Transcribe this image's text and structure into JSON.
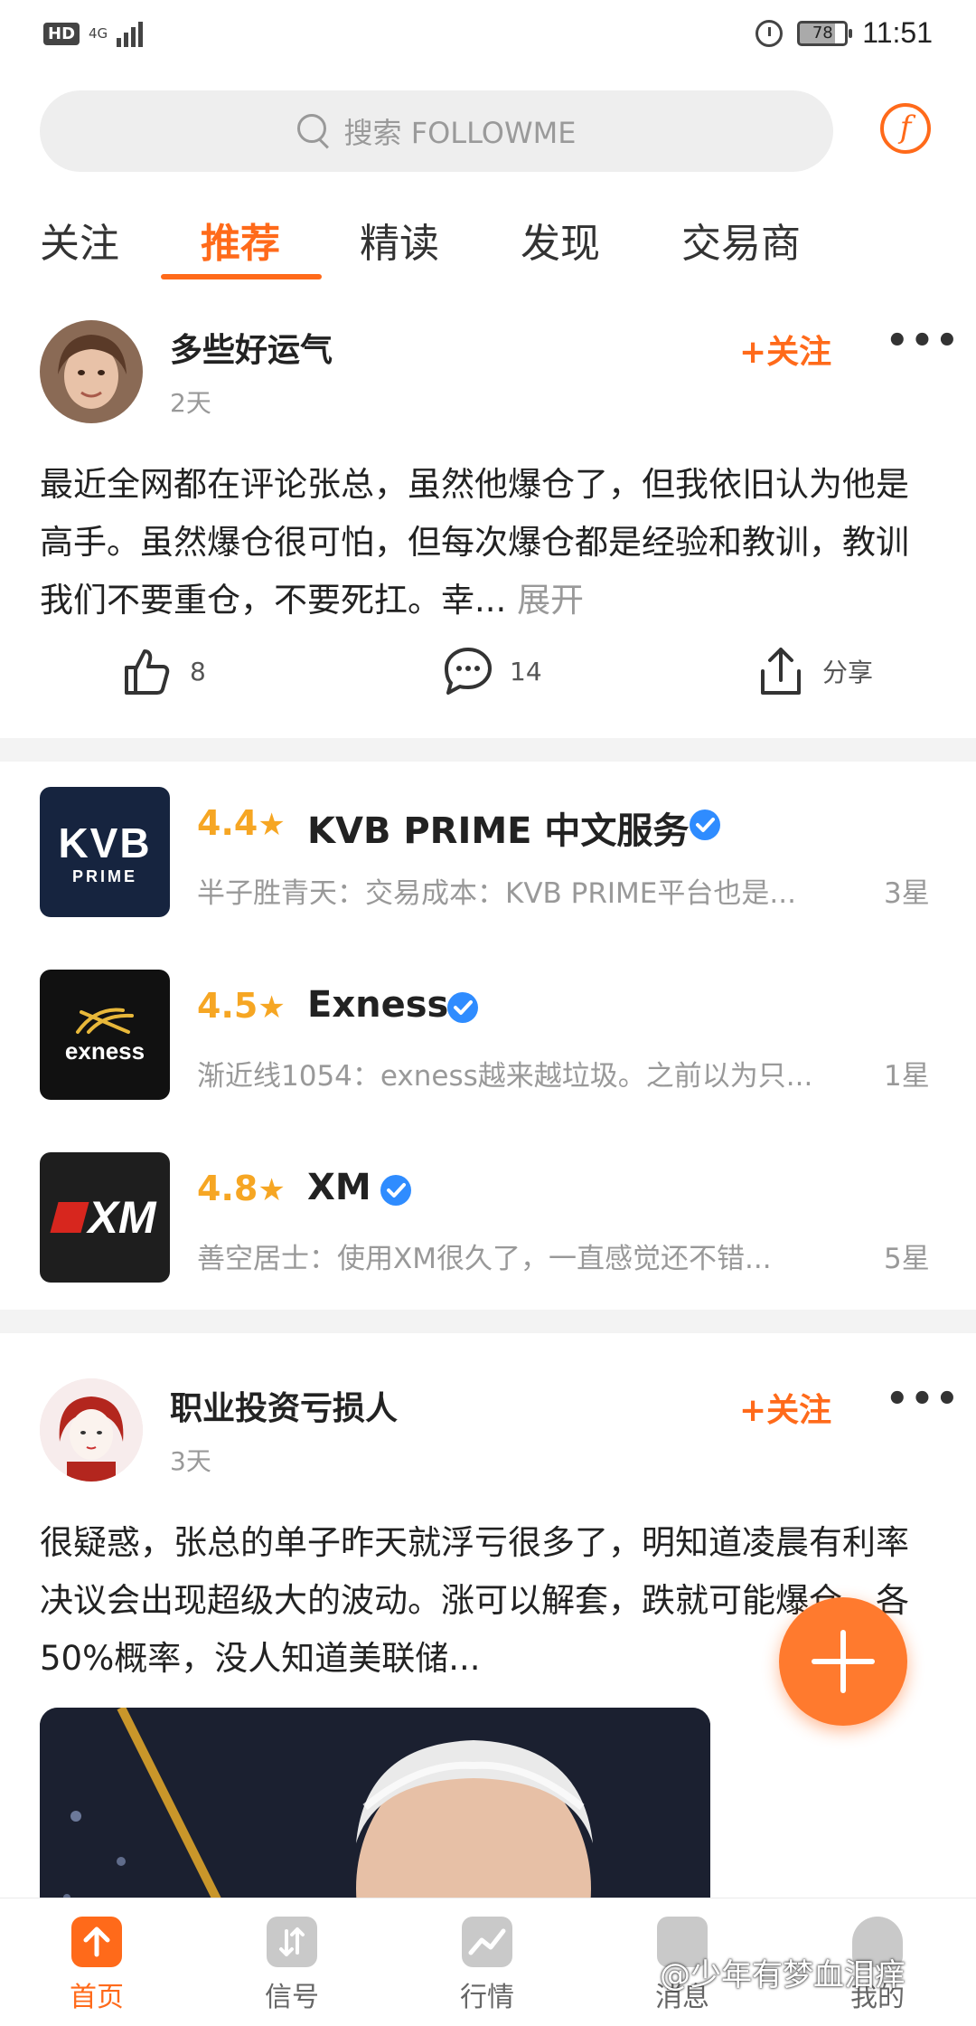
{
  "status_bar": {
    "hd": "HD",
    "network": "4G",
    "battery": "78",
    "time": "11:51"
  },
  "search": {
    "placeholder": "搜索 FOLLOWME"
  },
  "tabs": [
    {
      "label": "关注",
      "active": false
    },
    {
      "label": "推荐",
      "active": true
    },
    {
      "label": "精读",
      "active": false
    },
    {
      "label": "发现",
      "active": false
    },
    {
      "label": "交易商",
      "active": false
    }
  ],
  "posts": [
    {
      "author": "多些好运气",
      "time": "2天",
      "follow_label": "+关注",
      "more_label": "•••",
      "body": "最近全网都在评论张总，虽然他爆仓了，但我依旧认为他是高手。虽然爆仓很可怕，但每次爆仓都是经验和教训，教训我们不要重仓，不要死扛。幸...",
      "expand_label": "展开",
      "likes": "8",
      "comments": "14",
      "share_label": "分享"
    },
    {
      "author": "职业投资亏损人",
      "time": "3天",
      "follow_label": "+关注",
      "more_label": "•••",
      "body": "很疑惑，张总的单子昨天就浮亏很多了，明知道凌晨有利率决议会出现超级大的波动。涨可以解套，跌就可能爆仓。各50%概率，没人知道美联储..."
    }
  ],
  "brokers": [
    {
      "score": "4.4",
      "name": "KVB PRIME 中文服务",
      "logo_text": "KVB",
      "logo_sub": "PRIME",
      "logo_bg": "#16243f",
      "review": "半子胜青天：交易成本：KVB PRIME平台也是...",
      "rating": "3星"
    },
    {
      "score": "4.5",
      "name": "Exness",
      "logo_text": "exness",
      "logo_bg": "#111111",
      "review": "渐近线1054：exness越来越垃圾。之前以为只...",
      "rating": "1星"
    },
    {
      "score": "4.8",
      "name": "XM",
      "logo_text": "XM",
      "logo_bg": "#1e1e1e",
      "review": "善空居士：使用XM很久了，一直感觉还不错...",
      "rating": "5星"
    }
  ],
  "bottom_nav": [
    {
      "label": "首页",
      "icon": "home-icon",
      "active": true
    },
    {
      "label": "信号",
      "icon": "signal-icon",
      "active": false
    },
    {
      "label": "行情",
      "icon": "market-icon",
      "active": false
    },
    {
      "label": "消息",
      "icon": "message-icon",
      "active": false
    },
    {
      "label": "我的",
      "icon": "profile-icon",
      "active": false
    }
  ],
  "watermark": "@少年有梦血泪痒",
  "colors": {
    "accent": "#ff6a1a",
    "star": "#f6a623",
    "verified": "#2f8cff"
  }
}
